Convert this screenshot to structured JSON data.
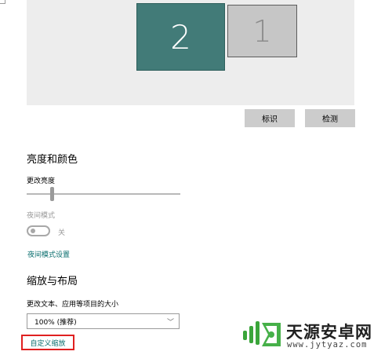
{
  "display": {
    "monitors": [
      {
        "number": "2",
        "state": "selected"
      },
      {
        "number": "1",
        "state": "unselected"
      }
    ],
    "identify_label": "标识",
    "detect_label": "检测"
  },
  "brightness_color": {
    "title": "亮度和颜色",
    "brightness_label": "更改亮度",
    "brightness_level": 0.16,
    "night_light_label": "夜间模式",
    "night_light_state": "关",
    "night_light_settings_link": "夜间模式设置"
  },
  "scale_layout": {
    "title": "缩放与布局",
    "text_size_label": "更改文本、应用等项目的大小",
    "text_size_value": "100% (推荐)",
    "custom_scaling_link": "自定义缩放"
  },
  "watermark": {
    "title": "天源安卓网",
    "url": "www.jytyaz.com"
  },
  "colors": {
    "accent": "#427b78",
    "link": "#0a6e6e",
    "highlight_box": "#e02020"
  }
}
